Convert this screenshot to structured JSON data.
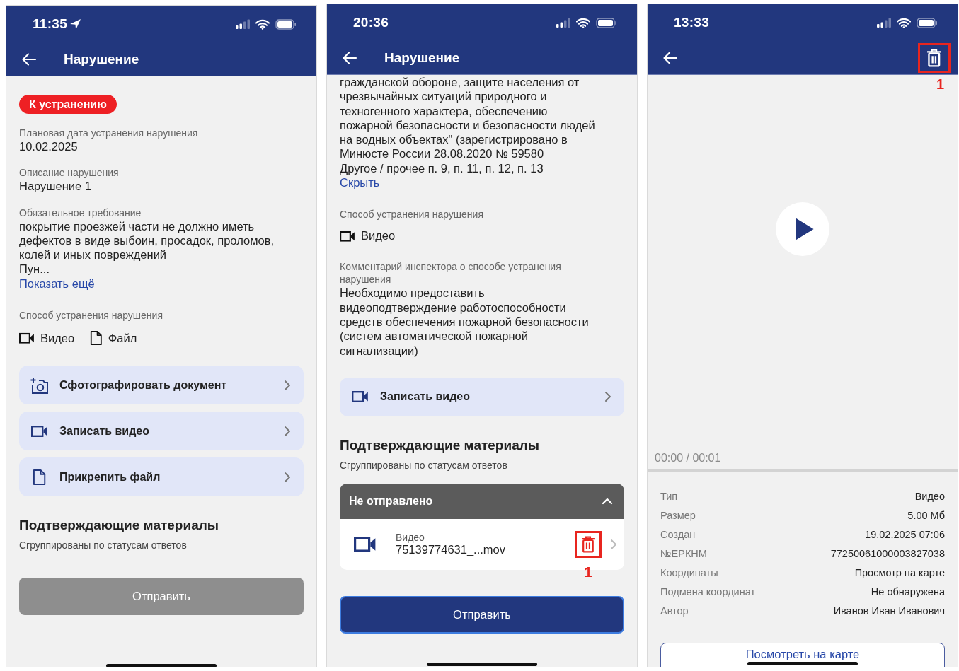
{
  "screens": [
    {
      "kind": "violation",
      "status_bar": {
        "time": "11:35",
        "location": true
      },
      "header": {
        "title": "Нарушение"
      },
      "blocks": [
        {
          "kind": "badge",
          "text": "К устранению"
        },
        {
          "kind": "field",
          "label": "Плановая дата устранения нарушения",
          "value": "10.02.2025"
        },
        {
          "kind": "field",
          "label": "Описание нарушения",
          "value": "Нарушение 1"
        },
        {
          "kind": "field",
          "label": "Обязательное требование",
          "value": "покрытие проезжей части не должно иметь\nдефектов в виде выбоин, просадок, проломов,\nколей и иных повреждений\nПун...",
          "link": "Показать ещё"
        },
        {
          "kind": "methods",
          "label": "Способ устранения нарушения",
          "items": [
            {
              "kind": "video",
              "text": "Видео"
            },
            {
              "kind": "file",
              "text": "Файл"
            }
          ]
        },
        {
          "kind": "action_photo",
          "text": "Сфотографировать документ"
        },
        {
          "kind": "action_video",
          "text": "Записать видео"
        },
        {
          "kind": "action_file",
          "text": "Прикрепить файл"
        },
        {
          "kind": "section",
          "title": "Подтверждающие материалы",
          "subtitle": "Сгруппированы по статусам ответов"
        },
        {
          "kind": "submit",
          "text": "Отправить",
          "disabled": true
        }
      ]
    },
    {
      "kind": "violation",
      "status_bar": {
        "time": "20:36",
        "location": false
      },
      "header": {
        "title": "Нарушение"
      },
      "blocks": [
        {
          "kind": "field",
          "value": "гражданской обороне, защите населения от\nчрезвычайных ситуаций природного и\nтехногенного характера, обеспечению\nпожарной безопасности и безопасности людей\nна водных объектах\" (зарегистрировано в\nМинюсте России 28.08.2020 № 59580\nДругое / прочее п. 9, п. 11, п. 12, п. 13",
          "link": "Скрыть"
        },
        {
          "kind": "methods",
          "label": "Способ устранения нарушения",
          "items": [
            {
              "kind": "video",
              "text": "Видео"
            }
          ]
        },
        {
          "kind": "field",
          "label": "Комментарий инспектора о способе устранения\nнарушения",
          "value": "Необходимо предоставить\nвидеоподтверждение работоспособности\nсредств обеспечения пожарной безопасности\n(систем автоматической пожарной\nсигнализации)"
        },
        {
          "kind": "action_video",
          "text": "Записать видео"
        },
        {
          "kind": "section",
          "title": "Подтверждающие материалы",
          "subtitle": "Сгруппированы по статусам ответов"
        },
        {
          "kind": "group",
          "title": "Не отправлено",
          "expanded": true,
          "items": [
            {
              "kind": "video",
              "type": "Видео",
              "name": "75139774631_...mov",
              "annotation": "1"
            }
          ]
        },
        {
          "kind": "submit",
          "text": "Отправить",
          "disabled": false
        }
      ]
    },
    {
      "kind": "media",
      "status_bar": {
        "time": "13:33",
        "location": false
      },
      "header": {
        "action": {
          "kind": "delete",
          "annotation": "1"
        }
      },
      "blocks": [
        {
          "kind": "player",
          "time": "00:00 / 00:01"
        },
        {
          "kind": "details",
          "rows": [
            {
              "label": "Тип",
              "value": "Видео"
            },
            {
              "label": "Размер",
              "value": "5.00 Мб"
            },
            {
              "label": "Создан",
              "value": "19.02.2025 07:06"
            },
            {
              "label": "№ЕРКНМ",
              "value": "77250061000003827038"
            },
            {
              "label": "Координаты",
              "value": "Просмотр на карте"
            },
            {
              "label": "Подмена координат",
              "value": "Не обнаружена"
            },
            {
              "label": "Автор",
              "value": "Иванов Иван Иванович"
            }
          ]
        },
        {
          "kind": "outline_button",
          "text": "Посмотреть на карте"
        }
      ]
    }
  ]
}
